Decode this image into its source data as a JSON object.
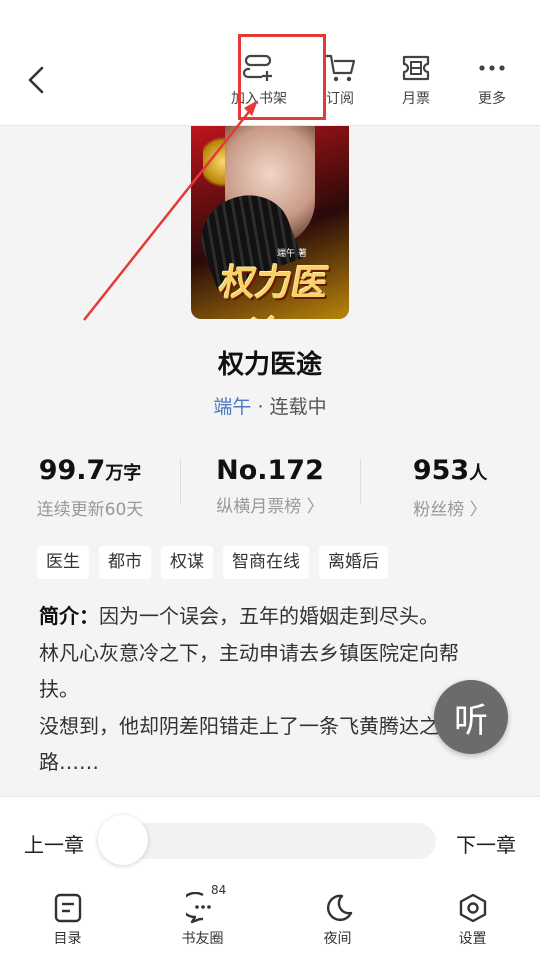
{
  "topbar": {
    "actions": [
      {
        "label": "加入书架",
        "icon": "add-to-shelf-icon"
      },
      {
        "label": "订阅",
        "icon": "cart-icon"
      },
      {
        "label": "月票",
        "icon": "ticket-icon"
      },
      {
        "label": "更多",
        "icon": "more-icon"
      }
    ]
  },
  "book": {
    "cover_title": "权力医途",
    "cover_author": "端午 著",
    "title": "权力医途",
    "author": "端午",
    "separator": " · ",
    "status": "连载中"
  },
  "stats": [
    {
      "value": "99.7",
      "unit": "万字",
      "label": "连续更新60天"
    },
    {
      "value": "No.172",
      "unit": "",
      "label": "纵横月票榜 〉"
    },
    {
      "value": "953",
      "unit": "人",
      "label": "粉丝榜 〉"
    }
  ],
  "tags": [
    "医生",
    "都市",
    "权谋",
    "智商在线",
    "离婚后"
  ],
  "intro": {
    "label": "简介：",
    "text": "因为一个误会，五年的婚姻走到尽头。",
    "line2": "林凡心灰意冷之下，主动申请去乡镇医院定向帮扶。",
    "line3": "没想到，他却阴差阳错走上了一条飞黄腾达之路……"
  },
  "listen_label": "听",
  "chapter_nav": {
    "prev": "上一章",
    "next": "下一章",
    "progress": 0
  },
  "tabbar": [
    {
      "label": "目录",
      "icon": "catalog-icon"
    },
    {
      "label": "书友圈",
      "icon": "chat-bubble-icon",
      "badge": "84"
    },
    {
      "label": "夜间",
      "icon": "moon-icon"
    },
    {
      "label": "设置",
      "icon": "settings-icon"
    }
  ],
  "colors": {
    "highlight": "#e53935",
    "author_link": "#4a78c2",
    "listen_button": "#6b6b6b"
  }
}
